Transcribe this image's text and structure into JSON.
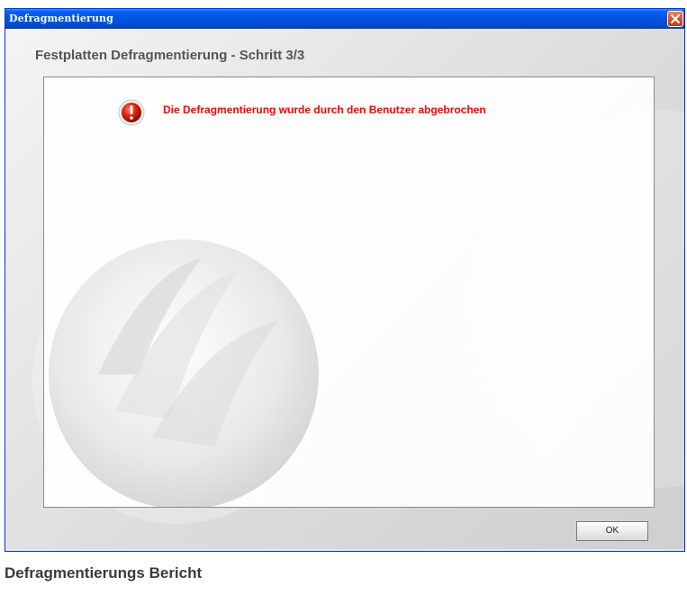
{
  "window": {
    "title": "Defragmentierung",
    "close_icon": "close-icon",
    "title_color": "#0054e3"
  },
  "dialog": {
    "heading": "Festplatten Defragmentierung - Schritt 3/3",
    "status_icon": "error-icon",
    "message": "Die Defragmentierung wurde durch den Benutzer abgebrochen",
    "message_color": "#ff0000",
    "ok_label": "OK"
  },
  "caption": "Defragmentierungs Bericht"
}
